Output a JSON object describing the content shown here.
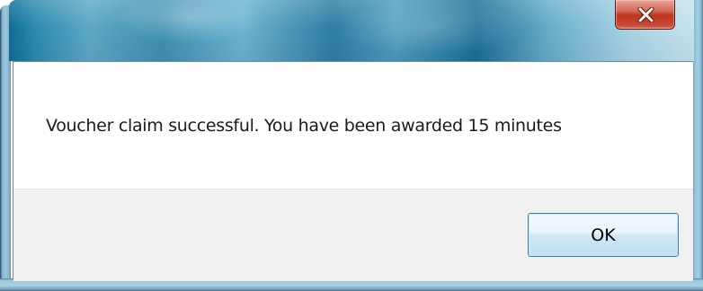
{
  "dialog": {
    "title": "",
    "message": "Voucher claim successful. You have been awarded 15 minutes",
    "close_icon": "close-x-icon",
    "buttons": {
      "ok_label": "OK"
    }
  },
  "colors": {
    "close_button": "#c7432d",
    "ok_button_border": "#3c7fb1",
    "button_area_bg": "#f0f0f0"
  }
}
